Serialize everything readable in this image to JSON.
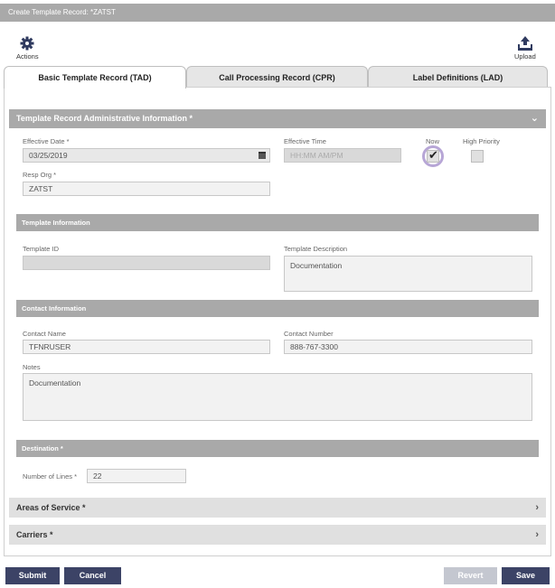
{
  "window": {
    "title": "Create Template Record: *ZATST"
  },
  "toolbar": {
    "actions_label": "Actions",
    "upload_label": "Upload"
  },
  "tabs": [
    {
      "label": "Basic Template Record (TAD)",
      "active": true
    },
    {
      "label": "Call Processing Record (CPR)",
      "active": false
    },
    {
      "label": "Label Definitions (LAD)",
      "active": false
    }
  ],
  "admin": {
    "title": "Template Record Administrative Information *",
    "effective_date_label": "Effective Date *",
    "effective_date_value": "03/25/2019",
    "effective_time_label": "Effective Time",
    "effective_time_placeholder": "HH:MM AM/PM",
    "now_label": "Now",
    "now_checked": true,
    "high_priority_label": "High Priority",
    "high_priority_checked": false,
    "resp_org_label": "Resp Org *",
    "resp_org_value": "ZATST"
  },
  "template_info": {
    "title": "Template Information",
    "template_id_label": "Template ID",
    "template_id_value": "",
    "template_desc_label": "Template Description",
    "template_desc_value": "Documentation"
  },
  "contact": {
    "title": "Contact Information",
    "name_label": "Contact Name",
    "name_value": "TFNRUSER",
    "number_label": "Contact Number",
    "number_value": "888-767-3300",
    "notes_label": "Notes",
    "notes_value": "Documentation"
  },
  "destination": {
    "title": "Destination *",
    "lines_label": "Number of Lines *",
    "lines_value": "22"
  },
  "collapsed_sections": {
    "areas": "Areas of Service *",
    "carriers": "Carriers *"
  },
  "buttons": {
    "submit": "Submit",
    "cancel": "Cancel",
    "revert": "Revert",
    "save": "Save"
  },
  "colors": {
    "section_header": "#a9a9a9",
    "button_primary": "#3c4366",
    "button_disabled": "#c4c7d0",
    "focus_ring": "#b7a6d6"
  }
}
